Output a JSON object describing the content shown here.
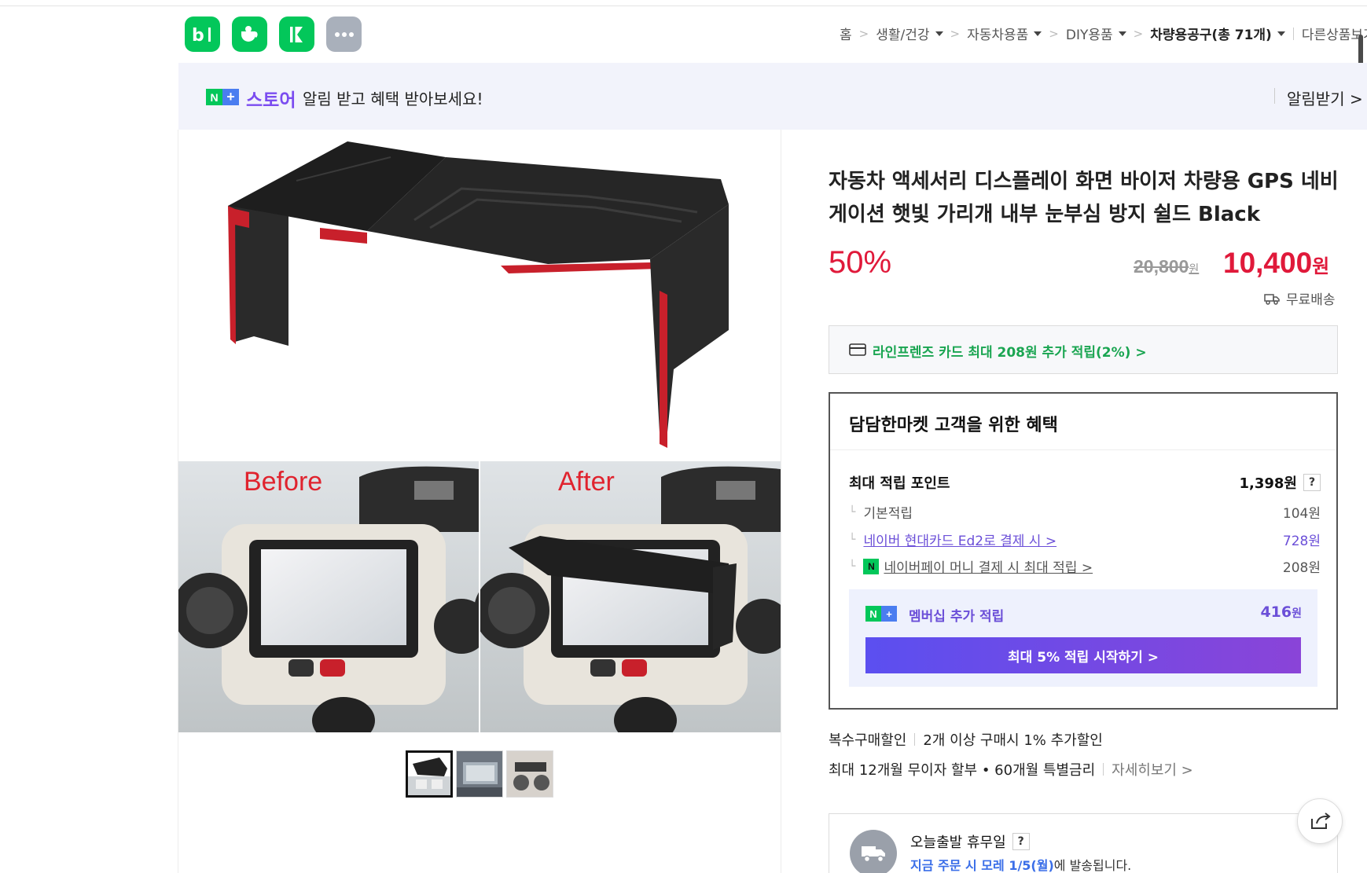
{
  "apps": [
    {
      "name": "blog",
      "label": "b|"
    },
    {
      "name": "cafe",
      "label": ""
    },
    {
      "name": "kinder",
      "label": ""
    },
    {
      "name": "more",
      "label": "···"
    }
  ],
  "breadcrumb": {
    "home": "홈",
    "items": [
      "생활/건강",
      "자동차용품",
      "DIY용품"
    ],
    "current": "차량용공구(총 71개)",
    "other": "다른상품보기"
  },
  "alert": {
    "badge_n": "N",
    "badge_plus": "+",
    "store": "스토어",
    "message": "알림 받고 혜택 받아보세요!",
    "button": "알림받기 >"
  },
  "product": {
    "title": "자동차 액세서리 디스플레이 화면 바이저 차량용 GPS 네비게이션 햇빛 가리개 내부 눈부심 방지 쉴드 Black",
    "discount": "50%",
    "original_price": "20,800",
    "original_unit": "원",
    "sale_price": "10,400",
    "sale_unit": "원",
    "shipping": "무료배송",
    "before_label": "Before",
    "after_label": "After"
  },
  "card_promo": "라인프렌즈 카드 최대 208원 추가 적립(2%) >",
  "benefit": {
    "title": "담담한마켓 고객을 위한 혜택",
    "max_points_label": "최대 적립 포인트",
    "max_points_value": "1,398원",
    "help": "?",
    "rows": [
      {
        "label": "기본적립",
        "value": "104원"
      },
      {
        "label": "네이버 현대카드 Ed2로 결제 시 >",
        "value": "728원"
      },
      {
        "label": "네이버페이 머니 결제 시 최대 적립 >",
        "value": "208원"
      }
    ],
    "member_label": "멤버십 추가 적립",
    "member_value": "416",
    "member_unit": "원",
    "member_button": "최대 5% 적립 시작하기 >"
  },
  "bulk": {
    "label": "복수구매할인",
    "text": "2개 이상 구매시 1% 추가할인"
  },
  "installment": {
    "text": "최대 12개월 무이자 할부 • 60개월 특별금리",
    "more": "자세히보기 >"
  },
  "dispatch": {
    "title": "오늘출발 휴무일",
    "help": "?",
    "note_highlight": "지금 주문 시 모레 1/5(월)",
    "note_rest": "에 발송됩니다."
  },
  "colors": {
    "accent_red": "#e0193a",
    "naver_green": "#03c75a",
    "store_purple": "#7b4cf0"
  }
}
